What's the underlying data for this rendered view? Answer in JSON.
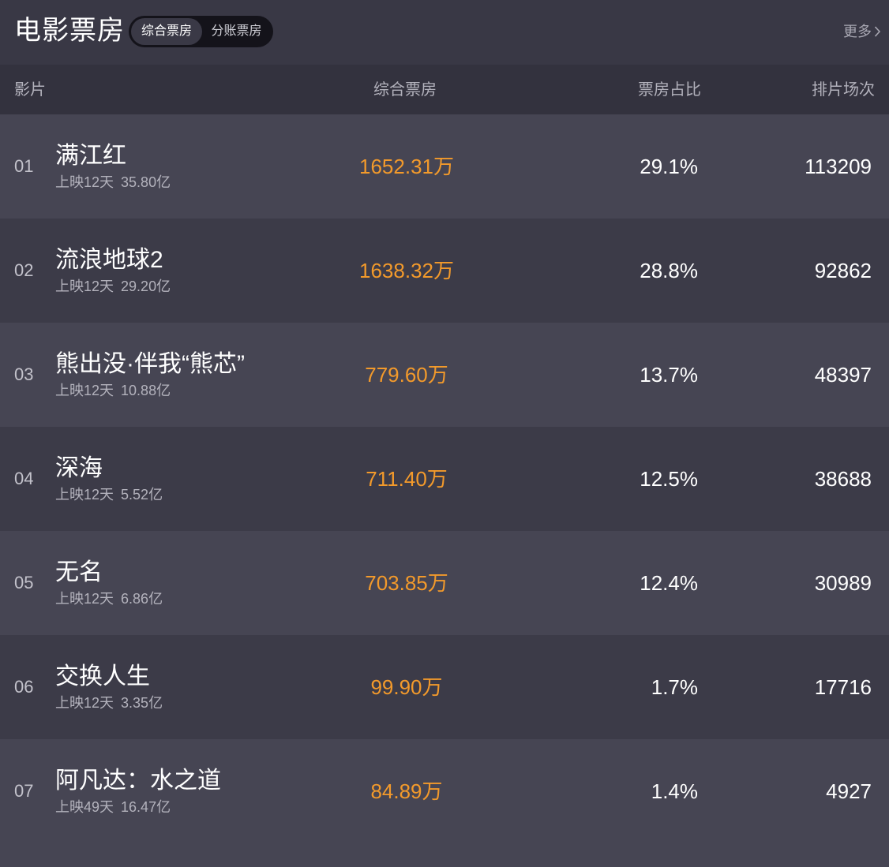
{
  "page_title": "电影票房",
  "tabs": [
    {
      "label": "综合票房",
      "active": true
    },
    {
      "label": "分账票房",
      "active": false
    }
  ],
  "more_label": "更多",
  "columns": {
    "film": "影片",
    "box_office": "综合票房",
    "share": "票房占比",
    "shows": "排片场次"
  },
  "colors": {
    "accent_orange": "#f39a2b",
    "bg_dark": "#3c3b48",
    "bg_row_alt": "#464553",
    "header_bg": "#33323e"
  },
  "movies": [
    {
      "rank": "01",
      "name": "满江红",
      "days": "上映12天",
      "total": "35.80亿",
      "box": "1652.31万",
      "share": "29.1%",
      "shows": "113209"
    },
    {
      "rank": "02",
      "name": "流浪地球2",
      "days": "上映12天",
      "total": "29.20亿",
      "box": "1638.32万",
      "share": "28.8%",
      "shows": "92862"
    },
    {
      "rank": "03",
      "name": "熊出没·伴我“熊芯”",
      "days": "上映12天",
      "total": "10.88亿",
      "box": "779.60万",
      "share": "13.7%",
      "shows": "48397"
    },
    {
      "rank": "04",
      "name": "深海",
      "days": "上映12天",
      "total": "5.52亿",
      "box": "711.40万",
      "share": "12.5%",
      "shows": "38688"
    },
    {
      "rank": "05",
      "name": "无名",
      "days": "上映12天",
      "total": "6.86亿",
      "box": "703.85万",
      "share": "12.4%",
      "shows": "30989"
    },
    {
      "rank": "06",
      "name": "交换人生",
      "days": "上映12天",
      "total": "3.35亿",
      "box": "99.90万",
      "share": "1.7%",
      "shows": "17716"
    },
    {
      "rank": "07",
      "name": "阿凡达：水之道",
      "days": "上映49天",
      "total": "16.47亿",
      "box": "84.89万",
      "share": "1.4%",
      "shows": "4927"
    }
  ]
}
